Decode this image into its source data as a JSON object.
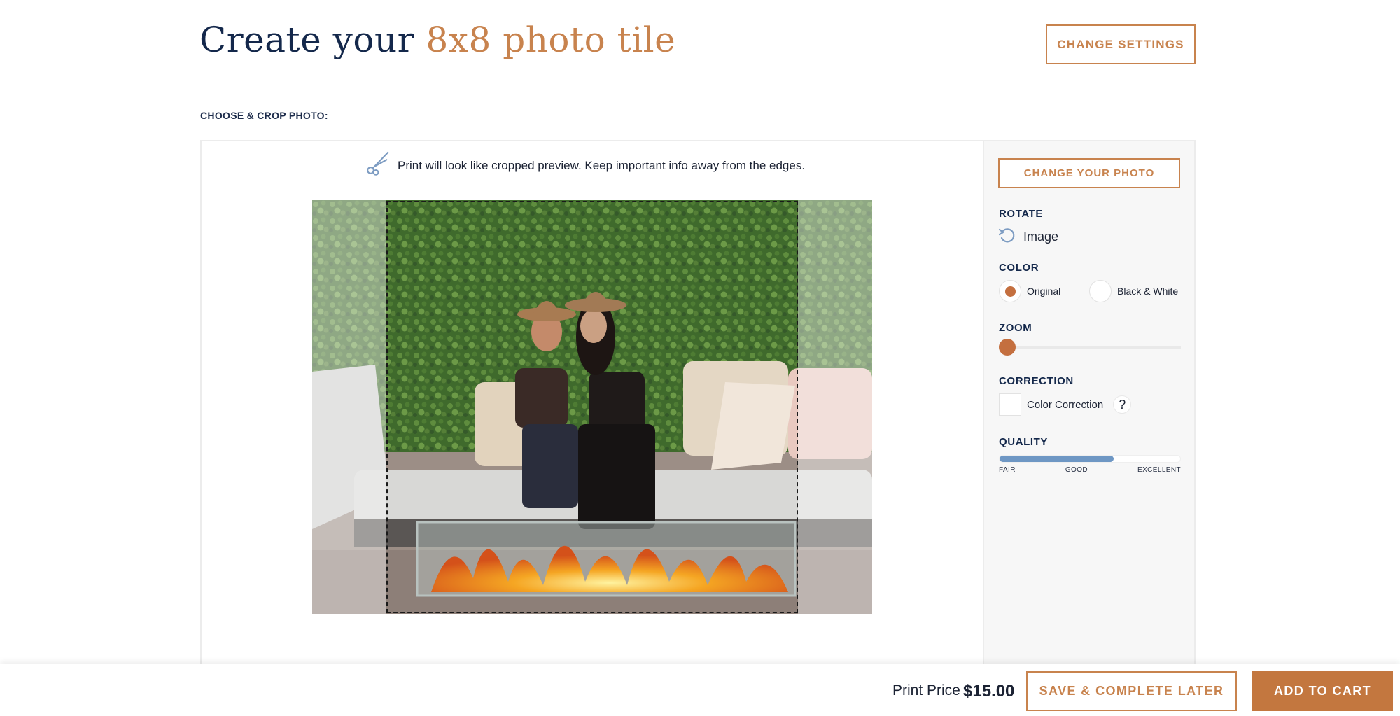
{
  "header": {
    "title_prefix": "Create your ",
    "title_accent": "8x8 photo tile",
    "change_settings_label": "CHANGE SETTINGS"
  },
  "editor": {
    "section_label": "CHOOSE & CROP PHOTO:",
    "tip_icon": "scissors-icon",
    "tip_text": "Print will look like cropped preview. Keep important info away from the edges."
  },
  "sidebar": {
    "change_photo_label": "CHANGE YOUR PHOTO",
    "rotate": {
      "heading": "ROTATE",
      "icon": "rotate-ccw-icon",
      "label": "Image"
    },
    "color": {
      "heading": "COLOR",
      "options": [
        {
          "label": "Original",
          "selected": true
        },
        {
          "label": "Black & White",
          "selected": false
        }
      ]
    },
    "zoom": {
      "heading": "ZOOM",
      "level": 0
    },
    "correction": {
      "heading": "CORRECTION",
      "label": "Color Correction",
      "checked": false,
      "help_label": "?"
    },
    "quality": {
      "heading": "QUALITY",
      "level": 0.63,
      "labels": [
        "FAIR",
        "GOOD",
        "EXCELLENT"
      ]
    }
  },
  "footer": {
    "price_label": "Print Price",
    "price_value": "$15.00",
    "save_label": "SAVE & COMPLETE LATER",
    "cart_label": "ADD TO CART"
  },
  "colors": {
    "navy": "#14284b",
    "accent": "#c8834e",
    "accent_fill": "#c3773f",
    "quality_blue": "#6e97c4"
  }
}
